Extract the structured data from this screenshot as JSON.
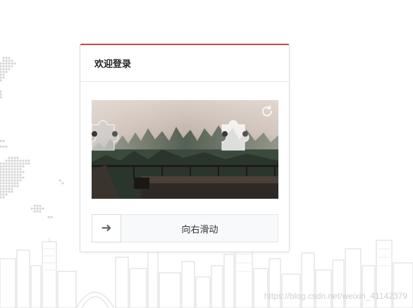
{
  "login": {
    "title": "欢迎登录"
  },
  "captcha": {
    "refresh_icon": "refresh-icon",
    "slider_text": "向右滑动",
    "slider_icon": "arrow-right-icon",
    "slider_arrow": "➜"
  },
  "watermark": "https://blog.csdn.net/weixin_41142379",
  "colors": {
    "accent": "#c24a4a",
    "border": "#dddddd",
    "slider_bg": "#f7f9fa"
  }
}
